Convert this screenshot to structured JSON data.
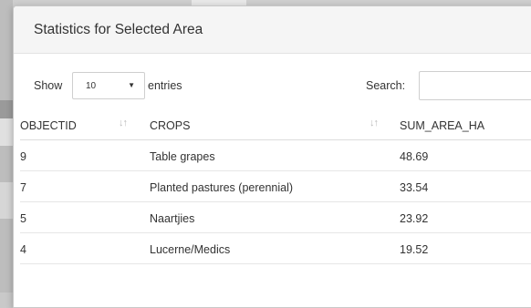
{
  "modal": {
    "title": "Statistics for Selected Area"
  },
  "controls": {
    "show_label": "Show",
    "page_length": "10",
    "entries_label": "entries",
    "search_label": "Search:",
    "search_value": ""
  },
  "table": {
    "columns": [
      "OBJECTID",
      "CROPS",
      "SUM_AREA_HA"
    ],
    "rows": [
      {
        "objectid": "9",
        "crops": "Table grapes",
        "sum_area_ha": "48.69"
      },
      {
        "objectid": "7",
        "crops": "Planted pastures (perennial)",
        "sum_area_ha": "33.54"
      },
      {
        "objectid": "5",
        "crops": "Naartjies",
        "sum_area_ha": "23.92"
      },
      {
        "objectid": "4",
        "crops": "Lucerne/Medics",
        "sum_area_ha": "19.52"
      }
    ]
  }
}
